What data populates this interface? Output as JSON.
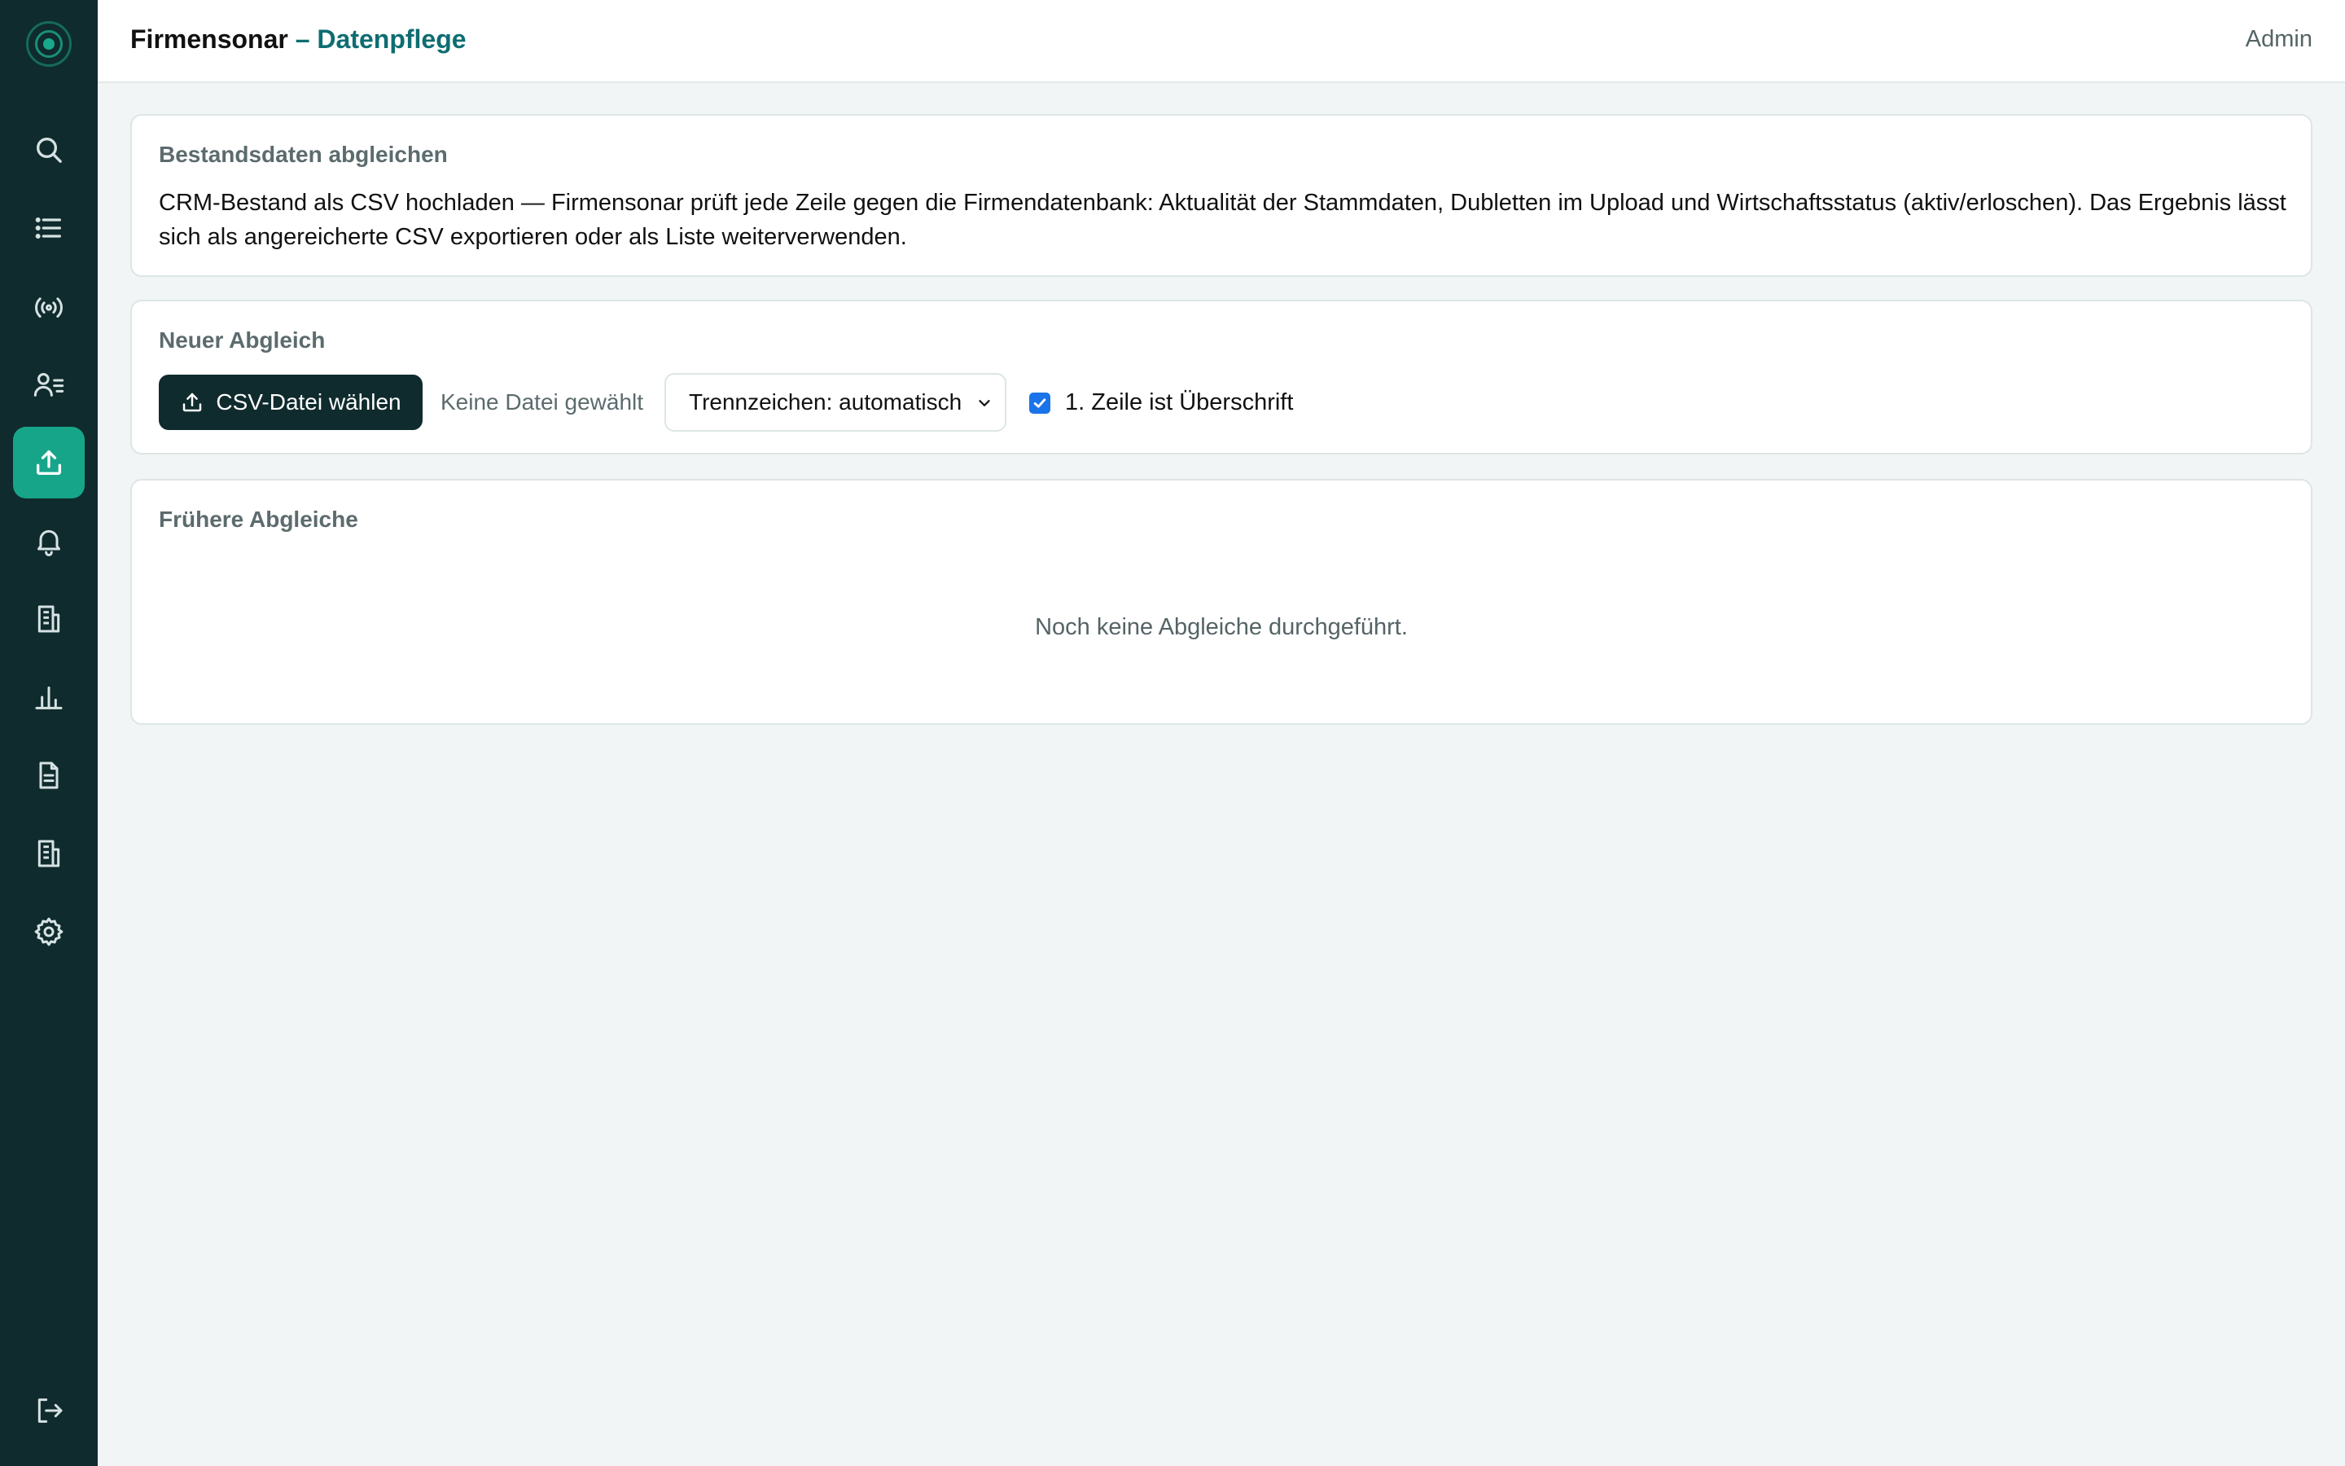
{
  "header": {
    "app_name": "Firmensonar",
    "separator": " – ",
    "section": "Datenpflege",
    "user": "Admin"
  },
  "sidebar": {
    "items": [
      {
        "icon": "search-icon"
      },
      {
        "icon": "list-icon"
      },
      {
        "icon": "radar-icon"
      },
      {
        "icon": "contacts-icon"
      },
      {
        "icon": "upload-icon",
        "active": true
      },
      {
        "icon": "bell-icon"
      },
      {
        "icon": "building-icon"
      },
      {
        "icon": "bar-chart-icon"
      },
      {
        "icon": "document-icon"
      },
      {
        "icon": "company-icon"
      },
      {
        "icon": "gear-icon"
      }
    ],
    "logout_icon": "logout-icon"
  },
  "intro": {
    "title": "Bestandsdaten abgleichen",
    "description": "CRM-Bestand als CSV hochladen — Firmensonar prüft jede Zeile gegen die Firmendatenbank: Aktualität der Stammdaten, Dubletten im Upload und Wirtschaftsstatus (aktiv/erloschen). Das Ergebnis lässt sich als angereicherte CSV exportieren oder als Liste weiterverwenden."
  },
  "new_match": {
    "title": "Neuer Abgleich",
    "upload_label": "CSV-Datei wählen",
    "file_status": "Keine Datei gewählt",
    "delimiter_selected": "Trennzeichen: automatisch",
    "header_checkbox_label": "1. Zeile ist Überschrift",
    "header_checkbox_checked": true
  },
  "history": {
    "title": "Frühere Abgleiche",
    "empty_text": "Noch keine Abgleiche durchgeführt."
  },
  "colors": {
    "sidebar_bg": "#0f2b2d",
    "accent": "#17a58a",
    "section_accent": "#0e6d72",
    "page_bg": "#f1f5f5"
  }
}
